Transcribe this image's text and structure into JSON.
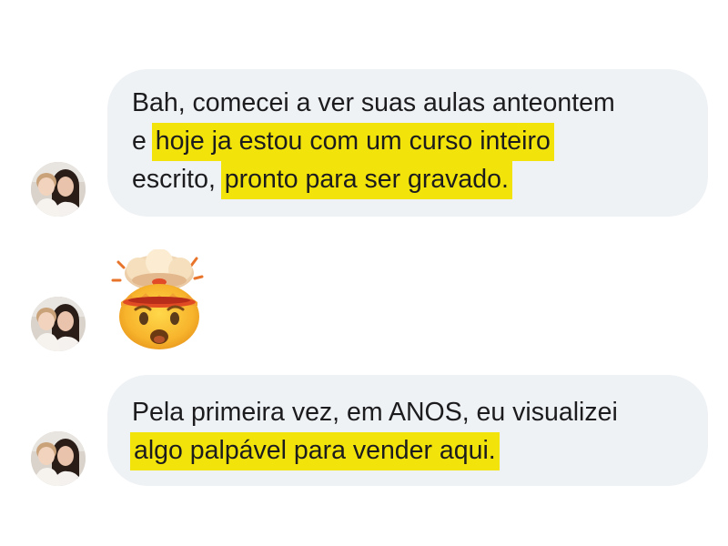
{
  "messages": [
    {
      "type": "text",
      "lines": [
        [
          {
            "text": "Bah, comecei a ver suas aulas anteontem",
            "highlight": false
          }
        ],
        [
          {
            "text": "e ",
            "highlight": false
          },
          {
            "text": "hoje ja estou com um curso inteiro",
            "highlight": true
          }
        ],
        [
          {
            "text": "escrito, ",
            "highlight": false
          },
          {
            "text": "pronto para ser gravado.",
            "highlight": true
          }
        ]
      ]
    },
    {
      "type": "emoji",
      "icon": "exploding-head-emoji"
    },
    {
      "type": "text",
      "lines": [
        [
          {
            "text": "Pela primeira vez, em ANOS, eu visualizei",
            "highlight": false
          }
        ],
        [
          {
            "text": "algo palpável para vender aqui.",
            "highlight": true
          }
        ]
      ]
    }
  ],
  "colors": {
    "bubble_background": "#eff2f5",
    "highlight": "#f2e40b",
    "text": "#1c1c1e"
  }
}
